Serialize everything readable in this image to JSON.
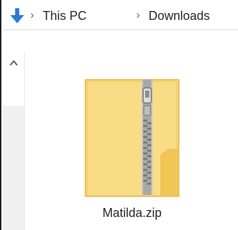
{
  "breadcrumb": {
    "items": [
      "This PC",
      "Downloads"
    ],
    "separator": "›"
  },
  "file": {
    "name": "Matilda.zip",
    "icon": "zip-folder-icon"
  },
  "colors": {
    "accent": "#2b7ad6",
    "folder": "#f8d775",
    "folder_dark": "#e9b94a"
  }
}
